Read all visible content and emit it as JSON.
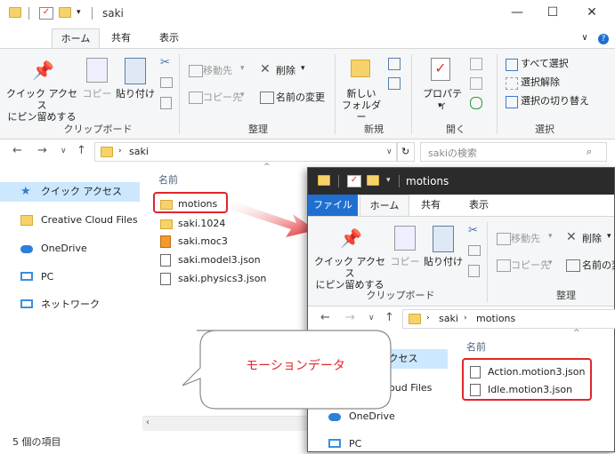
{
  "back_window": {
    "title": "saki",
    "tabs": [
      "ホーム",
      "共有",
      "表示"
    ],
    "clipboard": {
      "pin": "クイック アクセス\nにピン留めする",
      "copy": "コピー",
      "paste": "貼り付け",
      "group": "クリップボード"
    },
    "organize": {
      "move": "移動先",
      "copy_to": "コピー先",
      "delete": "削除",
      "rename": "名前の変更",
      "group": "整理"
    },
    "new": {
      "new_folder": "新しい\nフォルダー",
      "group": "新規"
    },
    "open": {
      "properties": "プロパティ",
      "group": "開く"
    },
    "select": {
      "select_all": "すべて選択",
      "select_none": "選択解除",
      "invert": "選択の切り替え",
      "group": "選択"
    },
    "address": "saki",
    "search_placeholder": "sakiの検索",
    "sidebar": [
      {
        "label": "クイック アクセス"
      },
      {
        "label": "Creative Cloud Files"
      },
      {
        "label": "OneDrive"
      },
      {
        "label": "PC"
      },
      {
        "label": "ネットワーク"
      }
    ],
    "column_header": "名前",
    "files": [
      {
        "name": "motions",
        "type": "folder"
      },
      {
        "name": "saki.1024",
        "type": "folder"
      },
      {
        "name": "saki.moc3",
        "type": "moc"
      },
      {
        "name": "saki.model3.json",
        "type": "json"
      },
      {
        "name": "saki.physics3.json",
        "type": "json"
      }
    ],
    "status": "5 個の項目"
  },
  "front_window": {
    "title": "motions",
    "tabs": [
      "ファイル",
      "ホーム",
      "共有",
      "表示"
    ],
    "clipboard": {
      "pin": "クイック アクセス\nにピン留めする",
      "copy": "コピー",
      "paste": "貼り付け",
      "group": "クリップボード"
    },
    "organize": {
      "move": "移動先",
      "copy_to": "コピー先",
      "delete": "削除",
      "rename": "名前の変",
      "group": "整理"
    },
    "breadcrumb": [
      "saki",
      "motions"
    ],
    "sidebar": [
      {
        "label": "アクセス"
      },
      {
        "label": "loud Files"
      },
      {
        "label": "OneDrive"
      },
      {
        "label": "PC"
      }
    ],
    "column_header": "名前",
    "files": [
      {
        "name": "Action.motion3.json"
      },
      {
        "name": "Idle.motion3.json"
      }
    ]
  },
  "callout": {
    "text": "モーションデータ"
  },
  "colors": {
    "highlight": "#e0262a",
    "selection": "#cce8ff",
    "callout_text": "#e0262a"
  }
}
